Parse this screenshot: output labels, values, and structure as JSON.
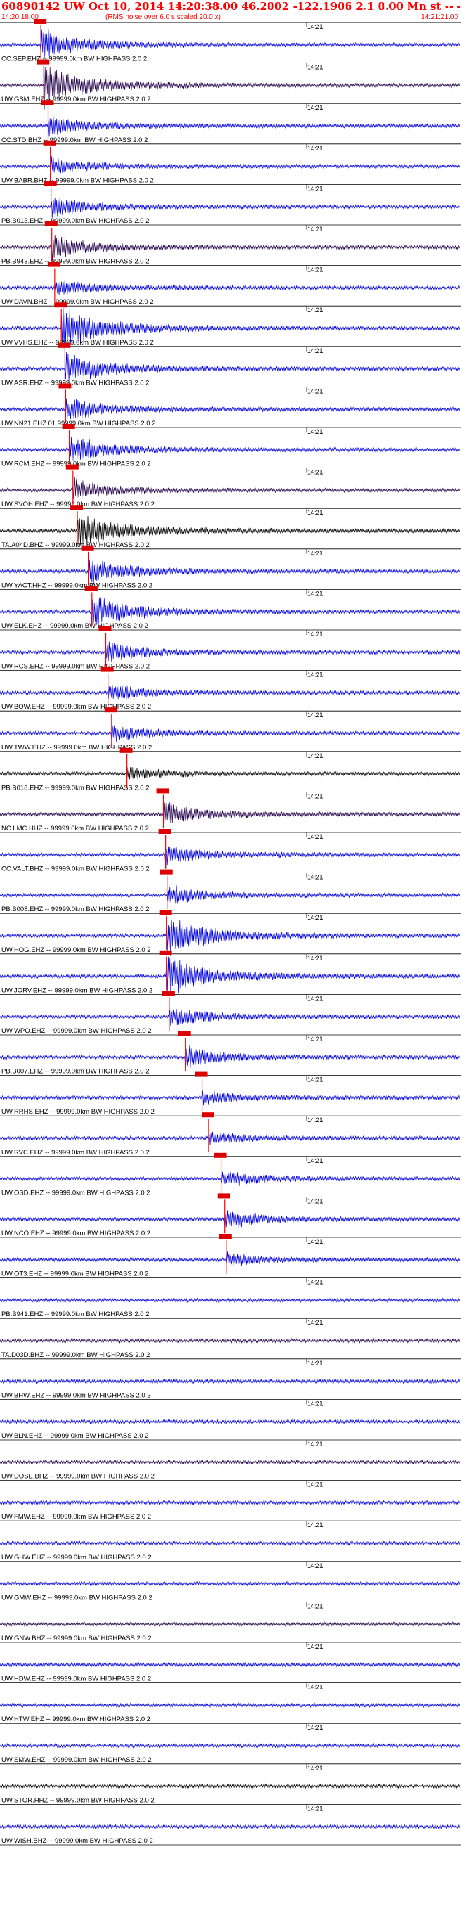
{
  "header": {
    "title": "60890142 UW Oct 10, 2014 14:20:38.00   46.2002 -122.1906  2.1 0.00 Mn st -- -- --  -1",
    "start_time": "14:20:18.00",
    "scaling_note": "(RMS noise over 6.0 s scaled 20.0 x)",
    "end_time": "14:21:21.00"
  },
  "chart_data": {
    "type": "line",
    "title": "60890142 UW Oct 10, 2014 14:20:38.00   46.2002 -122.1906  2.1 0.00 Mn st -- -- --  -1",
    "x_range_s": [
      0,
      63
    ],
    "minute_tick_label": "14:21",
    "minute_tick_s": 42,
    "colors": {
      "blue": "#0000dd",
      "black": "#000000",
      "dark": "#22004a",
      "pick_line": "#ff0000",
      "pick_box": "#dd0000"
    },
    "traces": [
      {
        "label": "CC.SEP.EHZ -- 99999.0km BW  HIGHPASS  2.0  2",
        "pick_s": 5.6,
        "color": "blue",
        "event": 0.9
      },
      {
        "label": "UW.GSM.EHZ -- 99999.0km BW  HIGHPASS  2.0  2",
        "pick_s": 6.0,
        "color": "dark",
        "event": 1.3
      },
      {
        "label": "CC.STD.BHZ -- 99999.0km BW  HIGHPASS  2.0  2",
        "pick_s": 6.6,
        "color": "blue",
        "event": 0.6
      },
      {
        "label": "UW.BABR.BHZ -- 99999.0km BW  HIGHPASS  2.0  2",
        "pick_s": 6.9,
        "color": "blue",
        "event": 0.5
      },
      {
        "label": "PB.B013.EHZ -- 99999.0km BW  HIGHPASS  2.0  2",
        "pick_s": 7.0,
        "color": "blue",
        "event": 0.6
      },
      {
        "label": "PB.B943.EHZ -- 99999.0km BW  HIGHPASS  2.0  2",
        "pick_s": 7.1,
        "color": "dark",
        "event": 0.7
      },
      {
        "label": "UW.DAVN.BHZ -- 99999.0km BW  HIGHPASS  2.0  2",
        "pick_s": 7.5,
        "color": "blue",
        "event": 0.5
      },
      {
        "label": "UW.VVHS.EHZ -- 99999.0km BW  HIGHPASS  2.0  2",
        "pick_s": 8.4,
        "color": "blue",
        "event": 1.4
      },
      {
        "label": "UW.ASR.EHZ -- 99999.0km BW  HIGHPASS  2.0  2",
        "pick_s": 8.9,
        "color": "blue",
        "event": 1.0
      },
      {
        "label": "UW.NN21.EHZ.01 99999.0km BW  HIGHPASS  2.0  2",
        "pick_s": 9.0,
        "color": "blue",
        "event": 0.7
      },
      {
        "label": "UW.RCM.EHZ -- 99999.0km BW  HIGHPASS  2.0  2",
        "pick_s": 9.5,
        "color": "blue",
        "event": 0.8
      },
      {
        "label": "UW.SVOH.EHZ -- 99999.0km BW  HIGHPASS  2.0  2",
        "pick_s": 10.0,
        "color": "dark",
        "event": 0.6
      },
      {
        "label": "TA.A04D.BHZ -- 99999.0km BW  HIGHPASS  2.0  2",
        "pick_s": 10.6,
        "color": "black",
        "event": 1.2
      },
      {
        "label": "UW.YACT.HHZ -- 99999.0km BW  HIGHPASS  2.0  2",
        "pick_s": 12.1,
        "color": "blue",
        "event": 0.8
      },
      {
        "label": "UW.ELK.EHZ -- 99999.0km BW  HIGHPASS  2.0  2",
        "pick_s": 12.6,
        "color": "blue",
        "event": 1.0
      },
      {
        "label": "UW.RCS.EHZ -- 99999.0km BW  HIGHPASS  2.0  2",
        "pick_s": 14.5,
        "color": "blue",
        "event": 0.6
      },
      {
        "label": "UW.BOW.EHZ -- 99999.0km BW  HIGHPASS  2.0  2",
        "pick_s": 14.8,
        "color": "blue",
        "event": 0.5
      },
      {
        "label": "UW.TWW.EHZ -- 99999.0km BW  HIGHPASS  2.0  2",
        "pick_s": 15.3,
        "color": "blue",
        "event": 0.5
      },
      {
        "label": "PB.B018.EHZ -- 99999.0km BW  HIGHPASS  2.0  2",
        "pick_s": 17.4,
        "color": "black",
        "event": 0.4
      },
      {
        "label": "NC.LMC.HHZ -- 99999.0km BW  HIGHPASS  2.0  2",
        "pick_s": 22.4,
        "color": "dark",
        "event": 0.7
      },
      {
        "label": "CC.VALT.BHZ -- 99999.0km BW  HIGHPASS  2.0  2",
        "pick_s": 22.7,
        "color": "blue",
        "event": 0.6
      },
      {
        "label": "PB.B008.EHZ -- 99999.0km BW  HIGHPASS  2.0  2",
        "pick_s": 22.9,
        "color": "blue",
        "event": 0.6
      },
      {
        "label": "UW.HOG.EHZ -- 99999.0km BW  HIGHPASS  2.0  2",
        "pick_s": 22.8,
        "color": "blue",
        "event": 1.3
      },
      {
        "label": "UW.JORV.EHZ -- 99999.0km BW  HIGHPASS  2.0  2",
        "pick_s": 22.8,
        "color": "blue",
        "event": 1.3
      },
      {
        "label": "UW.WPO.EHZ -- 99999.0km BW  HIGHPASS  2.0  2",
        "pick_s": 23.2,
        "color": "blue",
        "event": 0.6
      },
      {
        "label": "PB.B007.EHZ -- 99999.0km BW  HIGHPASS  2.0  2",
        "pick_s": 25.4,
        "color": "blue",
        "event": 0.6
      },
      {
        "label": "UW.RRHS.EHZ -- 99999.0km BW  HIGHPASS  2.0  2",
        "pick_s": 27.7,
        "color": "blue",
        "event": 0.4
      },
      {
        "label": "UW.RVC.EHZ -- 99999.0km BW  HIGHPASS  2.0  2",
        "pick_s": 28.6,
        "color": "blue",
        "event": 0.4
      },
      {
        "label": "UW.OSD.EHZ -- 99999.0km BW  HIGHPASS  2.0  2",
        "pick_s": 30.3,
        "color": "blue",
        "event": 0.5
      },
      {
        "label": "UW.NCO.EHZ -- 99999.0km BW  HIGHPASS  2.0  2",
        "pick_s": 30.8,
        "color": "blue",
        "event": 0.5
      },
      {
        "label": "UW.OT3.EHZ -- 99999.0km BW  HIGHPASS  2.0  2",
        "pick_s": 31.0,
        "color": "blue",
        "event": 0.4
      },
      {
        "label": "PB.B941.EHZ -- 99999.0km BW  HIGHPASS  2.0  2",
        "pick_s": null,
        "color": "blue",
        "event": 0
      },
      {
        "label": "TA.D03D.BHZ -- 99999.0km BW  HIGHPASS  2.0  2",
        "pick_s": null,
        "color": "dark",
        "event": 0
      },
      {
        "label": "UW.BHW.EHZ -- 99999.0km BW  HIGHPASS  2.0  2",
        "pick_s": null,
        "color": "blue",
        "event": 0
      },
      {
        "label": "UW.BLN.EHZ -- 99999.0km BW  HIGHPASS  2.0  2",
        "pick_s": null,
        "color": "blue",
        "event": 0
      },
      {
        "label": "UW.DOSE.BHZ -- 99999.0km BW  HIGHPASS  2.0  2",
        "pick_s": null,
        "color": "dark",
        "event": 0
      },
      {
        "label": "UW.FMW.EHZ -- 99999.0km BW  HIGHPASS  2.0  2",
        "pick_s": null,
        "color": "blue",
        "event": 0
      },
      {
        "label": "UW.GHW.EHZ -- 99999.0km BW  HIGHPASS  2.0  2",
        "pick_s": null,
        "color": "blue",
        "event": 0
      },
      {
        "label": "UW.GMW.EHZ -- 99999.0km BW  HIGHPASS  2.0  2",
        "pick_s": null,
        "color": "blue",
        "event": 0
      },
      {
        "label": "UW.GNW.BHZ -- 99999.0km BW  HIGHPASS  2.0  2",
        "pick_s": null,
        "color": "dark",
        "event": 0
      },
      {
        "label": "UW.HDW.EHZ -- 99999.0km BW  HIGHPASS  2.0  2",
        "pick_s": null,
        "color": "blue",
        "event": 0
      },
      {
        "label": "UW.HTW.EHZ -- 99999.0km BW  HIGHPASS  2.0  2",
        "pick_s": null,
        "color": "blue",
        "event": 0
      },
      {
        "label": "UW.SMW.EHZ -- 99999.0km BW  HIGHPASS  2.0  2",
        "pick_s": null,
        "color": "blue",
        "event": 0
      },
      {
        "label": "UW.STOR.HHZ -- 99999.0km BW  HIGHPASS  2.0  2",
        "pick_s": null,
        "color": "black",
        "event": 0
      },
      {
        "label": "UW.WISH.BHZ -- 99999.0km BW  HIGHPASS  2.0  2",
        "pick_s": null,
        "color": "blue",
        "event": 0
      }
    ]
  }
}
